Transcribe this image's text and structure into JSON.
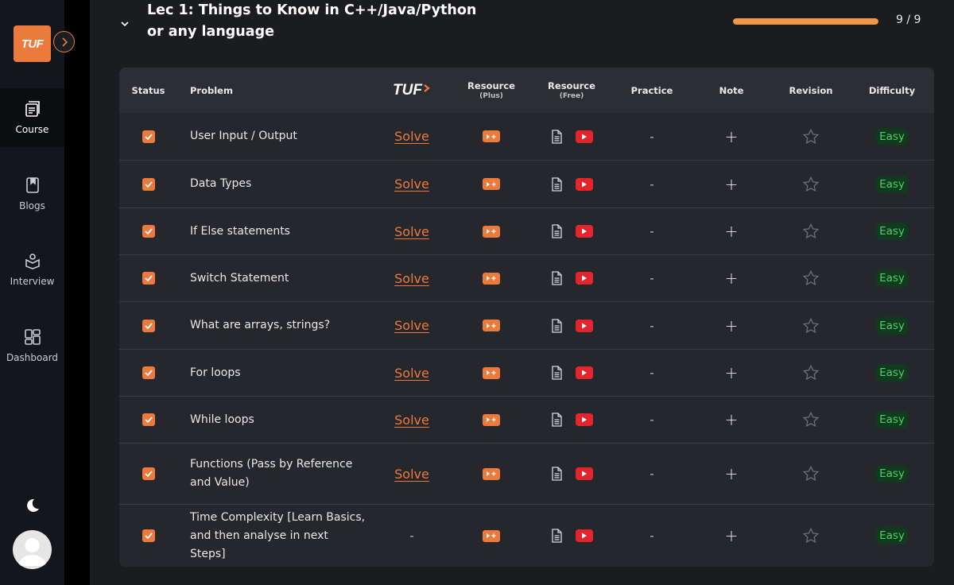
{
  "sidebar": {
    "logo_text": "TUF",
    "nav": [
      {
        "label": "Course",
        "icon": "course-icon",
        "active": true
      },
      {
        "label": "Blogs",
        "icon": "blog-icon",
        "active": false
      },
      {
        "label": "Interview",
        "icon": "interview-icon",
        "active": false
      },
      {
        "label": "Dashboard",
        "icon": "dashboard-icon",
        "active": false
      }
    ]
  },
  "section": {
    "title": "Lec 1: Things to Know in C++/Java/Python or any language",
    "progress_text": "9 / 9",
    "progress_fraction": 1.0
  },
  "table": {
    "headers": {
      "status": "Status",
      "problem": "Problem",
      "tuf_logo": "TUF",
      "resource_plus": "Resource",
      "resource_plus_sub": "(Plus)",
      "resource_free": "Resource",
      "resource_free_sub": "(Free)",
      "practice": "Practice",
      "note": "Note",
      "revision": "Revision",
      "difficulty": "Difficulty"
    },
    "rows": [
      {
        "problem": "User Input / Output",
        "solve": "Solve",
        "practice": "-",
        "note": "+",
        "difficulty": "Easy"
      },
      {
        "problem": "Data Types",
        "solve": "Solve",
        "practice": "-",
        "note": "+",
        "difficulty": "Easy"
      },
      {
        "problem": "If Else statements",
        "solve": "Solve",
        "practice": "-",
        "note": "+",
        "difficulty": "Easy"
      },
      {
        "problem": "Switch Statement",
        "solve": "Solve",
        "practice": "-",
        "note": "+",
        "difficulty": "Easy"
      },
      {
        "problem": "What are arrays, strings?",
        "solve": "Solve",
        "practice": "-",
        "note": "+",
        "difficulty": "Easy"
      },
      {
        "problem": "For loops",
        "solve": "Solve",
        "practice": "-",
        "note": "+",
        "difficulty": "Easy"
      },
      {
        "problem": "While loops",
        "solve": "Solve",
        "practice": "-",
        "note": "+",
        "difficulty": "Easy"
      },
      {
        "problem": "Functions (Pass by Reference and Value)",
        "solve": "Solve",
        "practice": "-",
        "note": "+",
        "difficulty": "Easy"
      },
      {
        "problem": "Time Complexity [Learn Basics, and then analyse in next Steps]",
        "solve": "-",
        "practice": "-",
        "note": "+",
        "difficulty": "Easy"
      }
    ]
  },
  "colors": {
    "accent": "#ec7a3d",
    "easy": "#4ad06a",
    "youtube": "#e4262c"
  }
}
